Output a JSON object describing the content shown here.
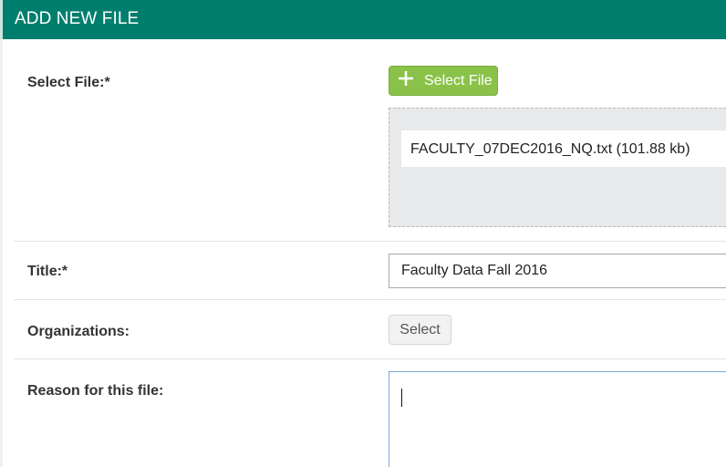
{
  "header": {
    "title": "ADD NEW FILE"
  },
  "form": {
    "select_file": {
      "label": "Select File:*",
      "button_label": "Select File",
      "button_icon": "plus-icon",
      "files": [
        {
          "name": "FACULTY_07DEC2016_NQ.txt (101.88 kb)"
        }
      ]
    },
    "title": {
      "label": "Title:*",
      "value": "Faculty Data Fall 2016"
    },
    "organizations": {
      "label": "Organizations:",
      "button_label": "Select"
    },
    "reason": {
      "label": "Reason for this file:",
      "value": ""
    }
  },
  "colors": {
    "header_bg": "#007e6d",
    "primary_button": "#8ac249",
    "dropzone_bg": "#e8e9ea",
    "focus_border": "#7fa6d8"
  }
}
